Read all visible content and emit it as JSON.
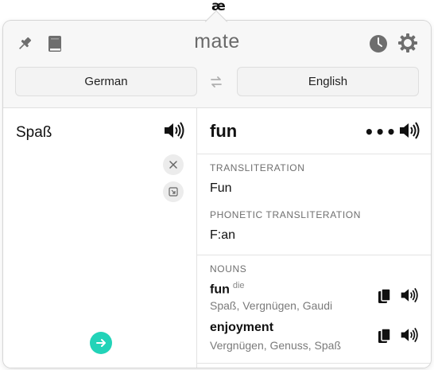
{
  "menubar": {
    "glyph": "æ"
  },
  "header": {
    "app_title": "mate",
    "icons": [
      "pin-icon",
      "book-icon",
      "clock-icon",
      "gear-icon"
    ],
    "source_language": "German",
    "target_language": "English"
  },
  "source": {
    "text": "Spaß"
  },
  "result": {
    "word": "fun",
    "more_label": "•••",
    "sections": {
      "transliteration_title": "TRANSLITERATION",
      "transliteration_value": "Fun",
      "phonetic_title": "PHONETIC TRANSLITERATION",
      "phonetic_value": "F:an",
      "nouns_title": "NOUNS"
    },
    "nouns": [
      {
        "word": "fun",
        "article": "die",
        "synonyms": "Spaß, Vergnügen, Gaudi"
      },
      {
        "word": "enjoyment",
        "article": "",
        "synonyms": "Vergnügen, Genuss, Spaß"
      }
    ]
  },
  "colors": {
    "accent": "#22d3b8",
    "icon_gray": "#6e6e6e",
    "background": "#f7f7f7"
  }
}
